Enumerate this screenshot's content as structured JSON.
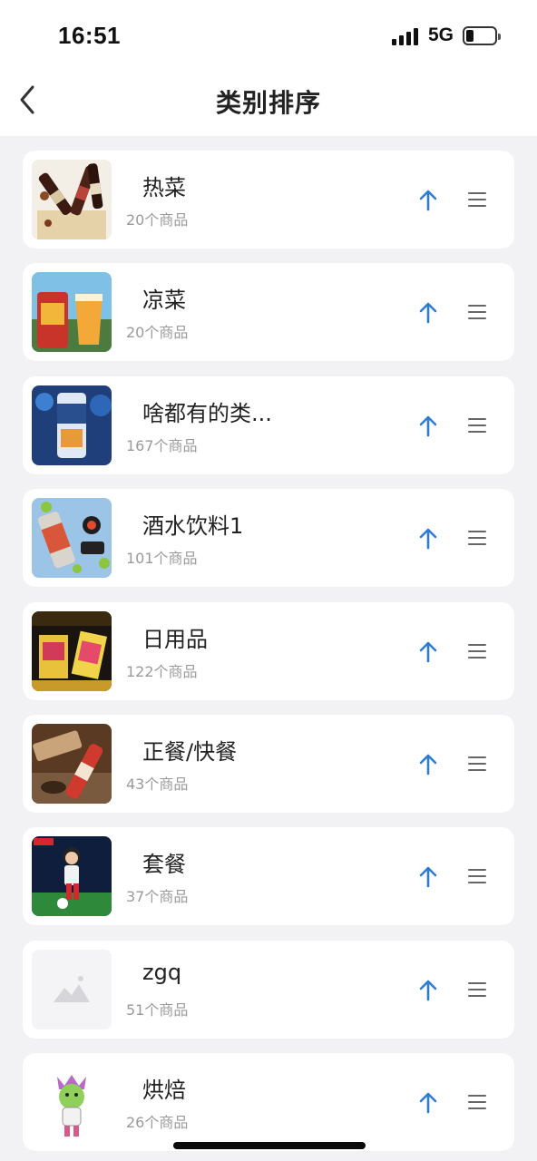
{
  "status_bar": {
    "time": "16:51",
    "network": "5G",
    "signal_bars": 4,
    "battery_level": 0.25
  },
  "header": {
    "title": "类别排序",
    "back_icon": "chevron-left-icon"
  },
  "colors": {
    "accent": "#2f7dd3",
    "background": "#f2f2f4",
    "card": "#ffffff",
    "muted_text": "#9a9a9a"
  },
  "categories": [
    {
      "name": "热菜",
      "count": "20个商品",
      "thumbnail": "beer-bottles-photo"
    },
    {
      "name": "凉菜",
      "count": "20个商品",
      "thumbnail": "beer-can-and-glass-photo"
    },
    {
      "name": "啥都有的类...",
      "count": "167个商品",
      "thumbnail": "blue-beer-can-photo"
    },
    {
      "name": "酒水饮料1",
      "count": "101个商品",
      "thumbnail": "beer-can-with-hops-photo"
    },
    {
      "name": "日用品",
      "count": "122个商品",
      "thumbnail": "bicycle-playing-cards-photo"
    },
    {
      "name": "正餐/快餐",
      "count": "43个商品",
      "thumbnail": "bottle-on-table-photo"
    },
    {
      "name": "套餐",
      "count": "37个商品",
      "thumbnail": "football-figure-photo"
    },
    {
      "name": "zgq",
      "count": "51个商品",
      "thumbnail": "image-placeholder-icon"
    },
    {
      "name": "烘焙",
      "count": "26个商品",
      "thumbnail": "cartoon-girl-figure-photo"
    }
  ],
  "row_icons": {
    "move_up": "arrow-up-icon",
    "drag": "drag-handle-icon"
  }
}
